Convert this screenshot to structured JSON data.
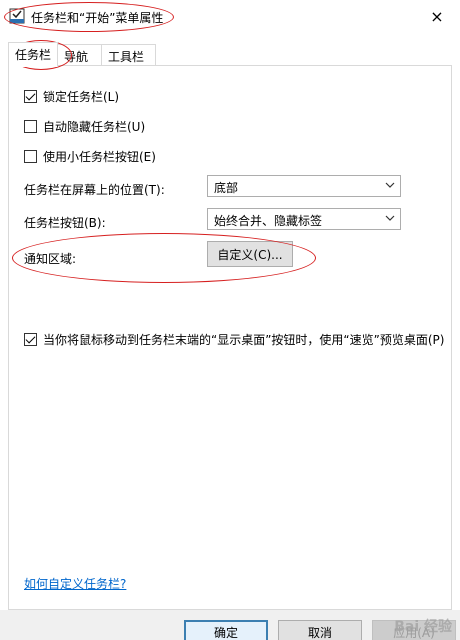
{
  "window": {
    "title": "任务栏和“开始”菜单属性",
    "close_icon": "×"
  },
  "tabs": [
    {
      "label": "任务栏",
      "active": true
    },
    {
      "label": "导航",
      "active": false
    },
    {
      "label": "工具栏",
      "active": false
    }
  ],
  "options": {
    "lock_taskbar": {
      "label": "锁定任务栏(L)",
      "checked": true
    },
    "auto_hide": {
      "label": "自动隐藏任务栏(U)",
      "checked": false
    },
    "small_buttons": {
      "label": "使用小任务栏按钮(E)",
      "checked": false
    },
    "peek": {
      "label": "当你将鼠标移动到任务栏末端的“显示桌面”按钮时，使用“速览”预览桌面(P)",
      "checked": true
    }
  },
  "position": {
    "label": "任务栏在屏幕上的位置(T):",
    "value": "底部"
  },
  "buttons_setting": {
    "label": "任务栏按钮(B):",
    "value": "始终合并、隐藏标签"
  },
  "notification": {
    "label": "通知区域:",
    "button_label": "自定义(C)..."
  },
  "help_link": "如何自定义任务栏?",
  "footer": {
    "ok_label": "确定",
    "cancel_label": "取消",
    "apply_label": "应用(A)"
  },
  "watermark": "Bai 经验",
  "colors": {
    "annotation": "#d62020",
    "link": "#0066cc",
    "accent": "#3c7fb1"
  }
}
